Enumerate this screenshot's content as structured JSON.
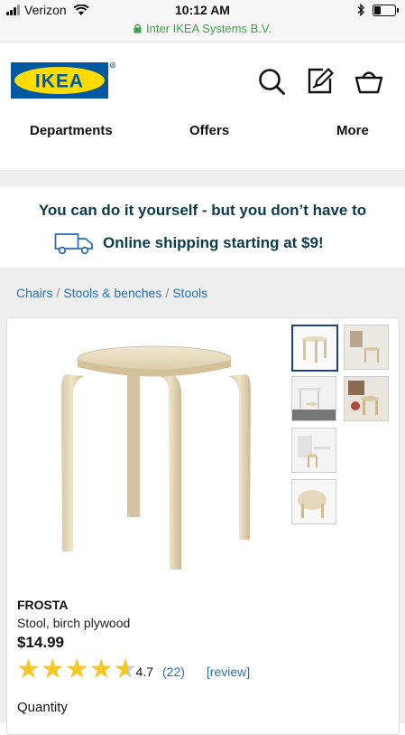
{
  "status_bar": {
    "carrier": "Verizon",
    "time": "10:12 AM",
    "wifi_icon": "wifi-icon",
    "bluetooth_icon": "bluetooth-icon",
    "battery_level": 0.3
  },
  "url_bar": {
    "site": "Inter IKEA Systems B.V.",
    "secure_color": "#3aa34a"
  },
  "header": {
    "logo_text": "IKEA",
    "logo_colors": {
      "blue": "#0058a3",
      "yellow": "#ffdb00"
    },
    "icons": [
      "search-icon",
      "edit-list-icon",
      "basket-icon"
    ]
  },
  "nav": {
    "items": [
      "Departments",
      "Offers",
      "More"
    ]
  },
  "promo": {
    "title": "You can do it yourself - but you don’t have to",
    "shipping": "Online shipping starting at $9!",
    "icon": "truck-icon"
  },
  "breadcrumb": [
    "Chairs",
    "Stools & benches",
    "Stools"
  ],
  "product": {
    "name": "FROSTA",
    "description": "Stool, birch plywood",
    "price": "$14.99",
    "rating": "4.7",
    "rating_value": 4.7,
    "rating_max": 5,
    "review_count": "(22)",
    "review_link": "[review]",
    "quantity_label": "Quantity",
    "thumbnails": [
      "stool-front",
      "stool-scene-1",
      "desk-scene",
      "stool-stack-scene",
      "room-scene",
      "stool-top"
    ]
  }
}
